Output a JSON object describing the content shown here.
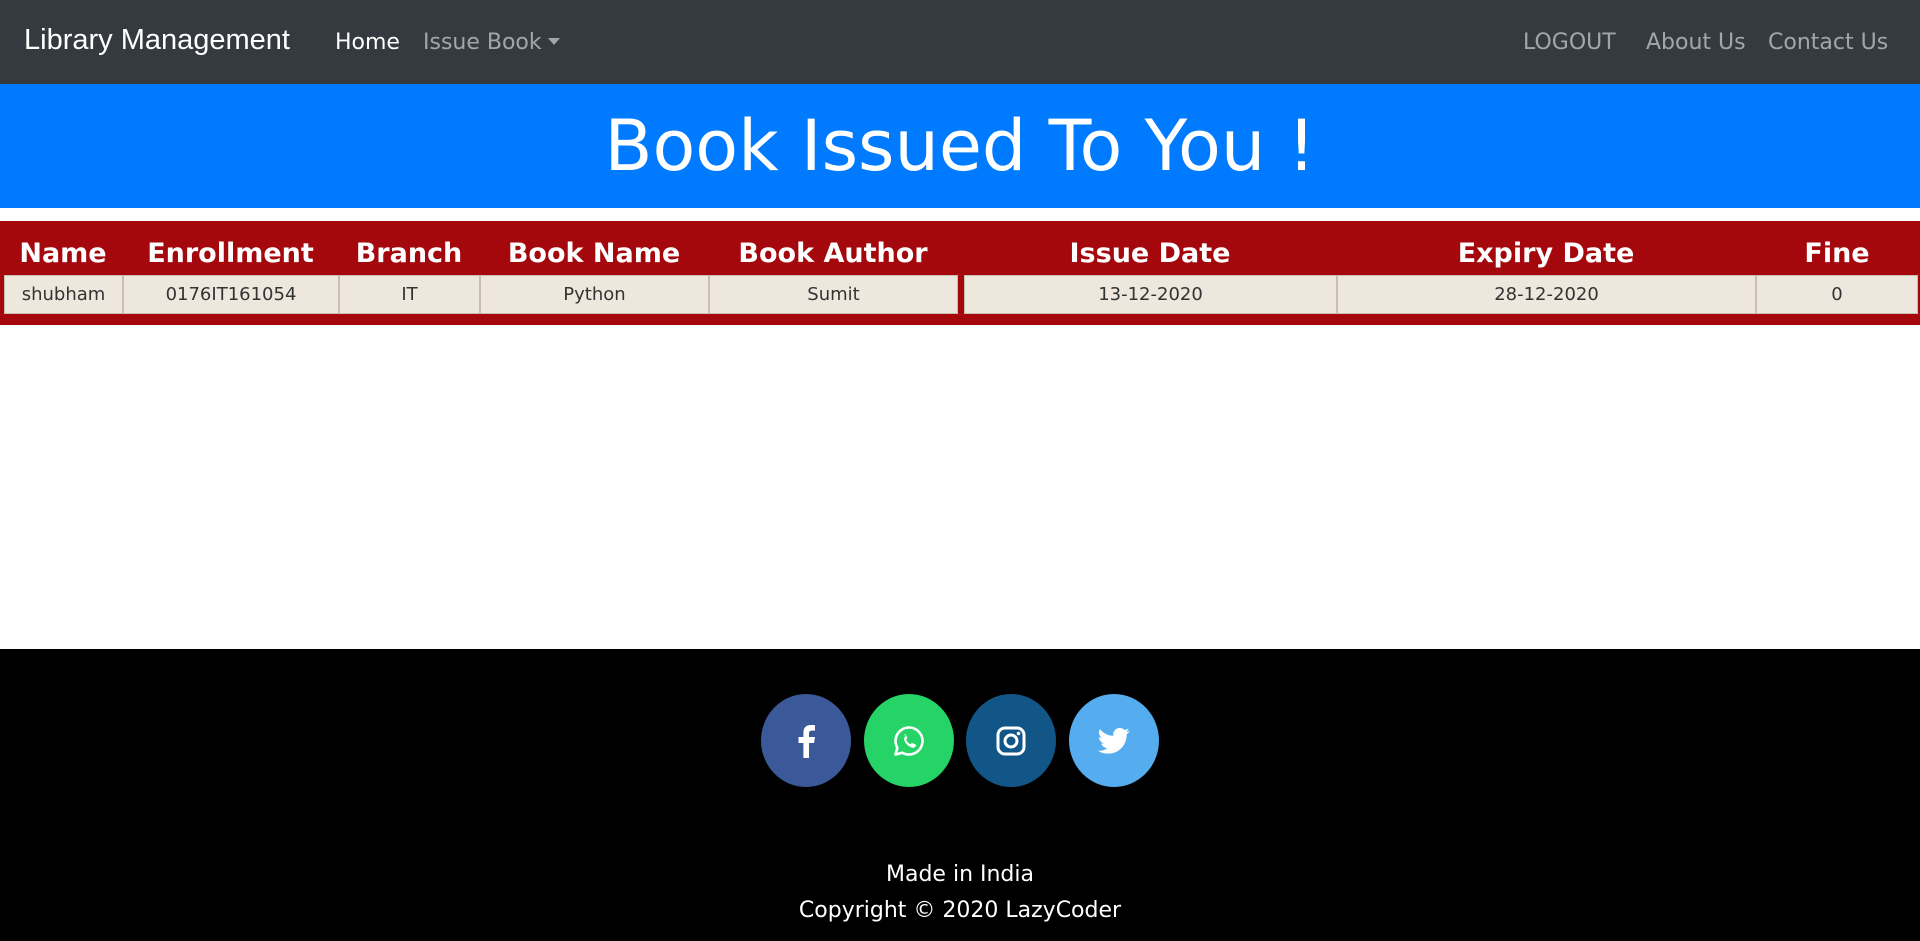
{
  "navbar": {
    "brand": "Library Management",
    "home_label": "Home",
    "issue_book_label": "Issue Book",
    "logout_label": "LOGOUT",
    "about_label": "About Us",
    "contact_label": "Contact Us"
  },
  "banner": {
    "title": "Book Issued To You !"
  },
  "table": {
    "headers": [
      "Name",
      "Enrollment",
      "Branch",
      "Book Name",
      "Book Author",
      "Issue Date",
      "Expiry Date",
      "Fine"
    ],
    "rows": [
      [
        "shubham",
        "0176IT161054",
        "IT",
        "Python",
        "Sumit",
        "13-12-2020",
        "28-12-2020",
        "0"
      ]
    ]
  },
  "footer": {
    "social_icons": [
      "facebook-icon",
      "whatsapp-icon",
      "instagram-icon",
      "twitter-icon"
    ],
    "made_in": "Made in India",
    "copyright": "Copyright © 2020 LazyCoder"
  },
  "colors": {
    "navbar": "#343a40",
    "banner": "#007bff",
    "table_band": "#a4070c",
    "cell_bg": "#ede7dd",
    "facebook": "#3b5998",
    "whatsapp": "#25d366",
    "instagram": "#125688",
    "twitter": "#55acee"
  }
}
